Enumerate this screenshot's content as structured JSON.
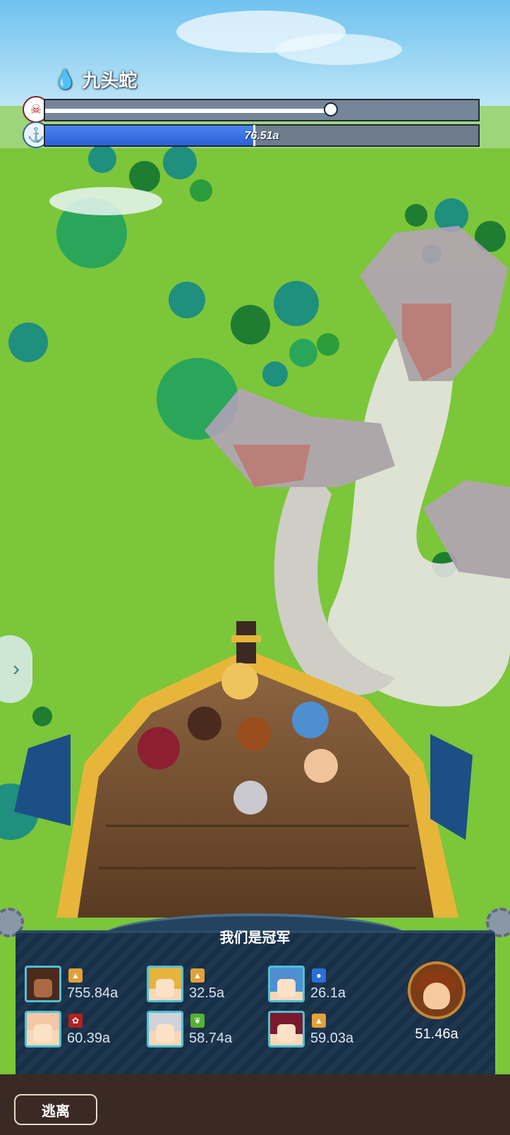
{
  "boss": {
    "name": "九头蛇",
    "element_icon": "water-drop-icon",
    "hp_fraction": 0.66,
    "timer_fraction": 0.48,
    "timer_text": "76.51a"
  },
  "colors": {
    "grass": "#7cc63a",
    "sky": "#8fd0f0",
    "panel": "#173048",
    "accent_teal": "#4ec1d5"
  },
  "side_tab": {
    "icon": "chevron-right-icon",
    "glyph": "›"
  },
  "team": {
    "title": "我们是冠军",
    "heroes": [
      {
        "name_icon": "hero-portrait-dark-hair",
        "element": "fire-element-icon",
        "element_color": "#e0a13a",
        "damage": "755.84a"
      },
      {
        "name_icon": "hero-portrait-blonde",
        "element": "fire-element-icon",
        "element_color": "#e0a13a",
        "damage": "32.5a"
      },
      {
        "name_icon": "hero-portrait-blue-hair",
        "element": "water-element-icon",
        "element_color": "#2b6fd6",
        "damage": "26.1a"
      },
      {
        "name_icon": "hero-portrait-bunny-girl",
        "element": "fire-element-icon",
        "element_color": "#b42020",
        "damage": "60.39a"
      },
      {
        "name_icon": "hero-portrait-silver-hair",
        "element": "wind-element-icon",
        "element_color": "#55b030",
        "damage": "58.74a"
      },
      {
        "name_icon": "hero-portrait-red-hair",
        "element": "fire-element-icon",
        "element_color": "#e0a13a",
        "damage": "59.03a"
      }
    ],
    "leader": {
      "icon": "leader-portrait-icon",
      "damage": "51.46a"
    }
  },
  "escape_button": "逃离"
}
